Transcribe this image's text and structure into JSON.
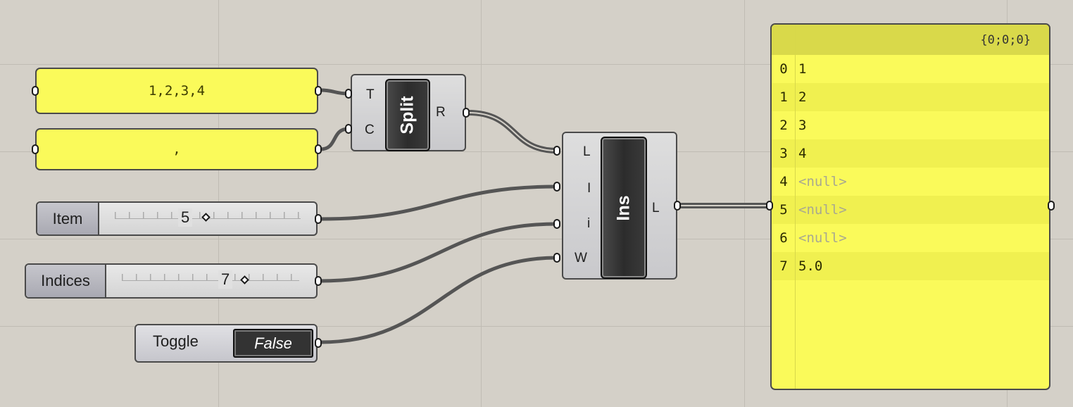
{
  "panels": {
    "text_panel": "1,2,3,4",
    "separator_panel": ","
  },
  "split_component": {
    "title": "Split",
    "inputs": [
      "T",
      "C"
    ],
    "output": "R"
  },
  "insert_component": {
    "title": "Ins",
    "inputs": [
      "L",
      "I",
      "i",
      "W"
    ],
    "output": "L"
  },
  "sliders": {
    "item": {
      "name": "Item",
      "value": "5"
    },
    "indices": {
      "name": "Indices",
      "value": "7"
    }
  },
  "toggle": {
    "name": "Toggle",
    "value": "False"
  },
  "viewer": {
    "path": "{0;0;0}",
    "rows": [
      {
        "index": "0",
        "value": "1"
      },
      {
        "index": "1",
        "value": "2"
      },
      {
        "index": "2",
        "value": "3"
      },
      {
        "index": "3",
        "value": "4"
      },
      {
        "index": "4",
        "value": "<null>"
      },
      {
        "index": "5",
        "value": "<null>"
      },
      {
        "index": "6",
        "value": "<null>"
      },
      {
        "index": "7",
        "value": "5.0"
      }
    ]
  },
  "colors": {
    "canvas": "#d4d0c8",
    "panel_fill": "#fafa5a",
    "wire": "#555555"
  }
}
